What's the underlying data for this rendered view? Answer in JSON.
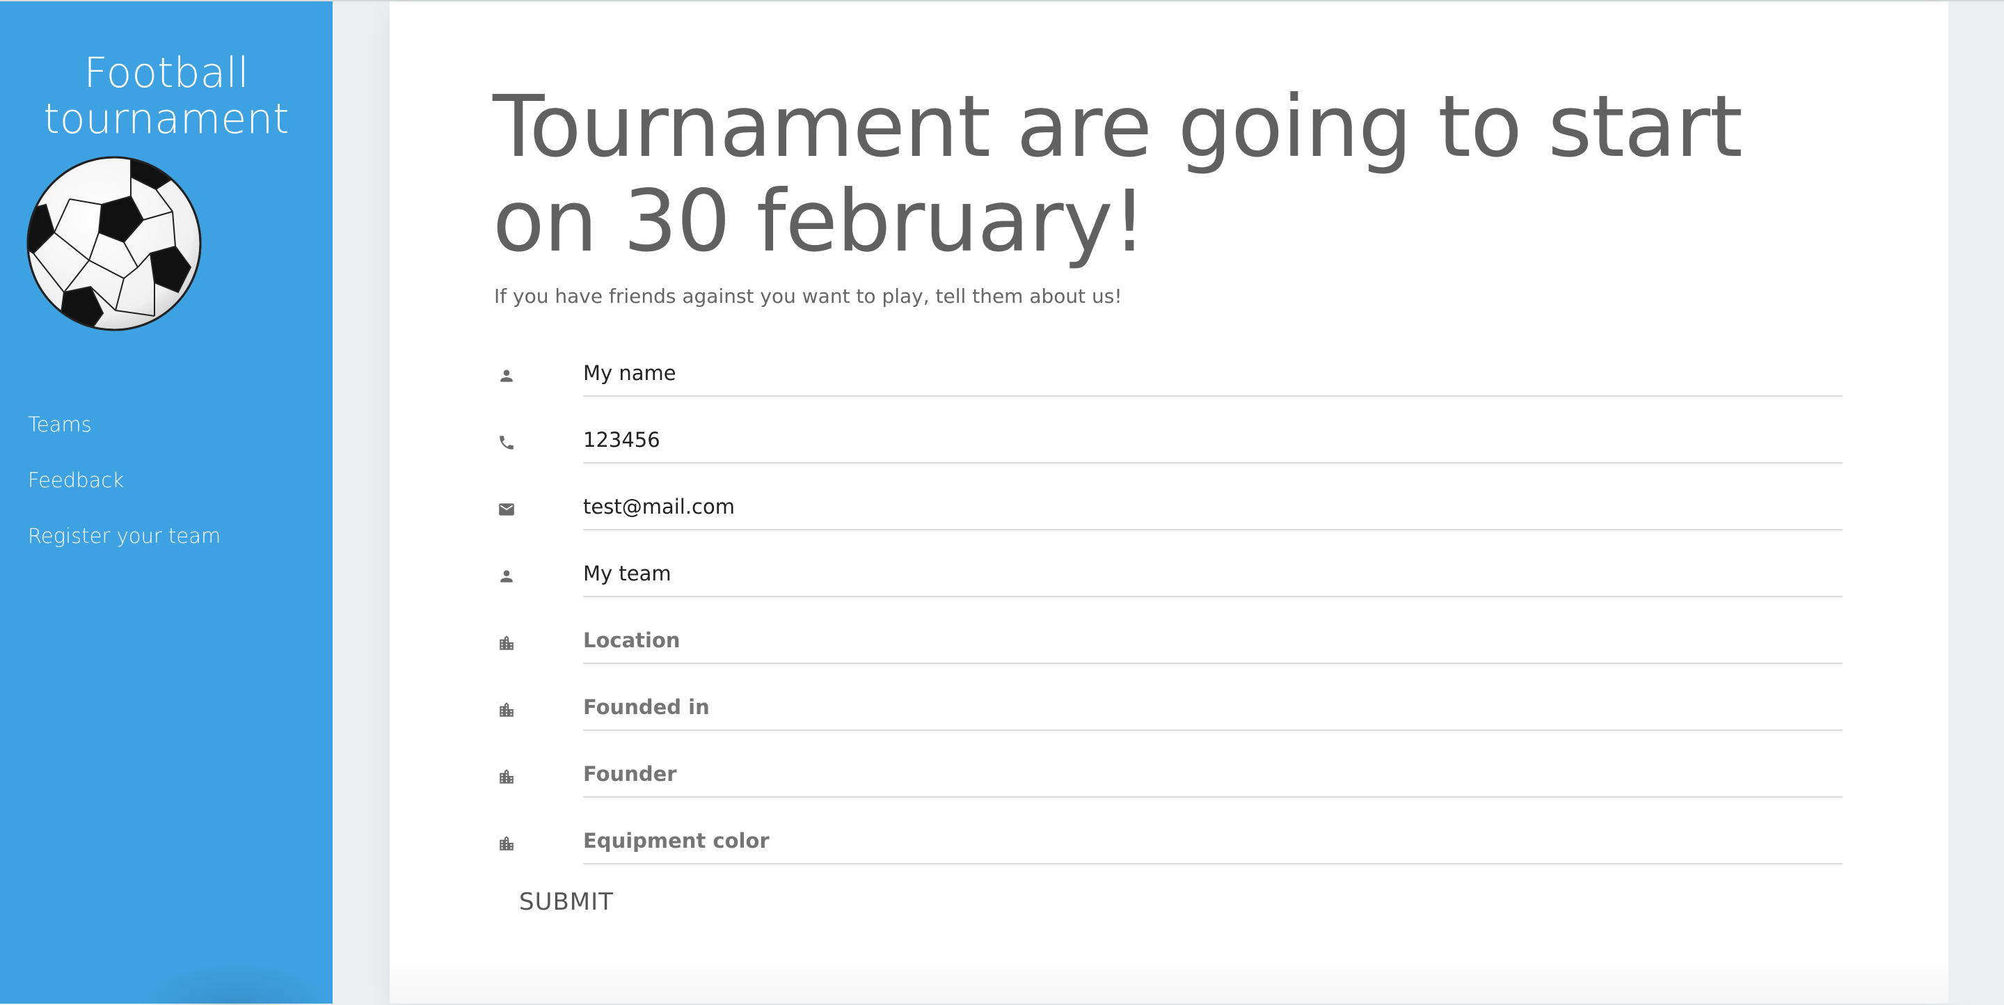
{
  "sidebar": {
    "brand_line1": "Football",
    "brand_line2": "tournament",
    "logo_icon": "soccer-ball-icon",
    "nav": [
      {
        "label": "Teams"
      },
      {
        "label": "Feedback"
      },
      {
        "label": "Register your team"
      }
    ]
  },
  "main": {
    "headline_line1": "Tournament are going to start",
    "headline_line2": "on 30 february!",
    "subline": "If you have friends against you want to play, tell them about us!",
    "form": {
      "fields": [
        {
          "icon": "person-icon",
          "value": "My name",
          "placeholder": ""
        },
        {
          "icon": "phone-icon",
          "value": "123456",
          "placeholder": ""
        },
        {
          "icon": "mail-icon",
          "value": "test@mail.com",
          "placeholder": ""
        },
        {
          "icon": "person-icon",
          "value": "My team",
          "placeholder": ""
        },
        {
          "icon": "city-icon",
          "value": "",
          "placeholder": "Location"
        },
        {
          "icon": "city-icon",
          "value": "",
          "placeholder": "Founded in"
        },
        {
          "icon": "city-icon",
          "value": "",
          "placeholder": "Founder"
        },
        {
          "icon": "city-icon",
          "value": "",
          "placeholder": "Equipment color"
        }
      ],
      "submit_label": "SUBMIT"
    }
  },
  "colors": {
    "sidebar": "#3ea1e1",
    "background": "#eceff0",
    "card": "#ffffff",
    "text": "#616161"
  }
}
